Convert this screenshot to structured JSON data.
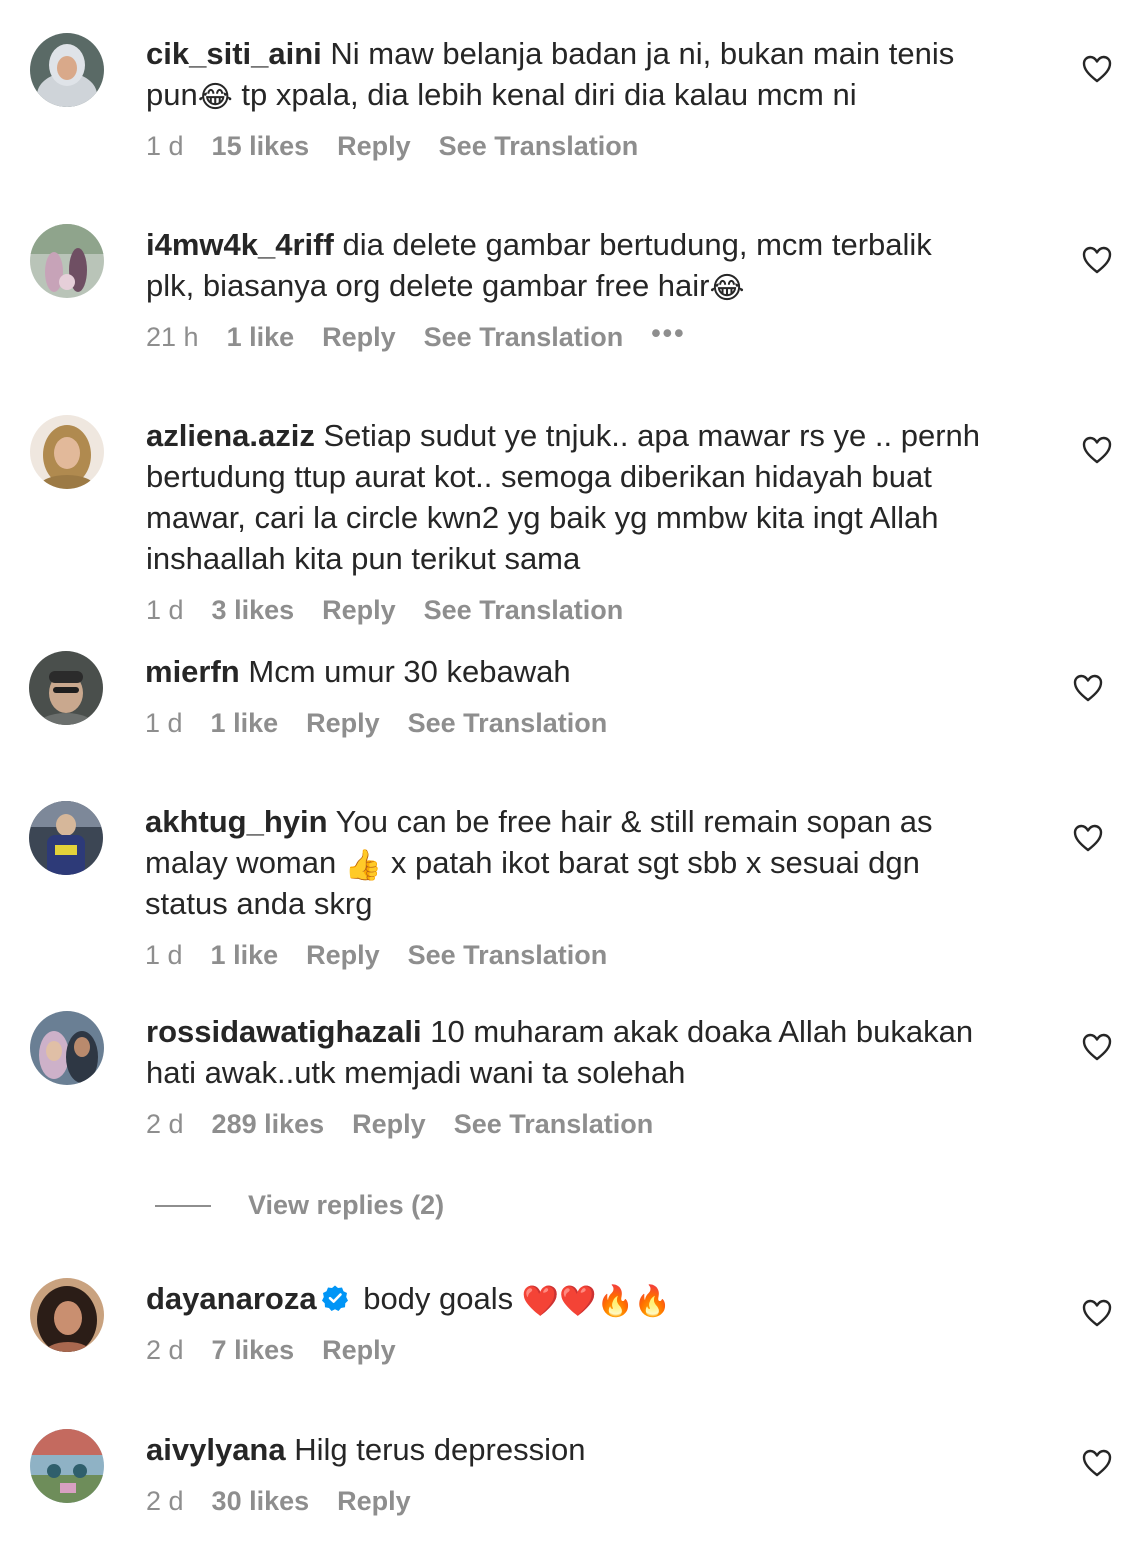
{
  "comments": [
    {
      "username": "cik_siti_aini",
      "text_lines": [
        "Ni maw belanja badan ja ni, bukan main tenis",
        "pun",
        "tp xpala, dia lebih kenal diri dia kalau mcm ni"
      ],
      "emoji": "😂",
      "time": "1 d",
      "likes": "15 likes",
      "reply": "Reply",
      "translation": "See Translation"
    },
    {
      "username": "i4mw4k_4riff",
      "text_lines": [
        "dia delete gambar bertudung, mcm terbalik",
        "plk, biasanya org delete gambar free hair"
      ],
      "emoji": "😂",
      "time": "21 h",
      "likes": "1 like",
      "reply": "Reply",
      "translation": "See Translation",
      "more": "•••"
    },
    {
      "username": "azliena.aziz",
      "text_lines": [
        "Setiap sudut ye tnjuk.. apa mawar rs ye .. pernh",
        "bertudung ttup aurat kot.. semoga diberikan hidayah buat",
        "mawar, cari la circle kwn2 yg baik yg mmbw kita ingt Allah",
        "inshaallah kita pun terikut sama"
      ],
      "time": "1 d",
      "likes": "3 likes",
      "reply": "Reply",
      "translation": "See Translation"
    },
    {
      "username": "mierfn",
      "text_lines": [
        "Mcm umur 30 kebawah"
      ],
      "time": "1 d",
      "likes": "1 like",
      "reply": "Reply",
      "translation": "See Translation"
    },
    {
      "username": "akhtug_hyin",
      "text_lines": [
        "You can be free hair & still remain sopan as",
        "malay woman",
        "x patah ikot barat sgt sbb x sesuai dgn",
        "status anda skrg"
      ],
      "emoji": "👍",
      "time": "1 d",
      "likes": "1 like",
      "reply": "Reply",
      "translation": "See Translation"
    },
    {
      "username": "rossidawatighazali",
      "text_lines": [
        "10 muharam akak doaka Allah bukakan",
        "hati awak..utk memjadi wani ta solehah"
      ],
      "time": "2 d",
      "likes": "289 likes",
      "reply": "Reply",
      "translation": "See Translation"
    },
    {
      "username": "dayanaroza",
      "text_lines": [
        "body goals"
      ],
      "emoji": "❤️❤️🔥🔥",
      "time": "2 d",
      "likes": "7 likes",
      "reply": "Reply"
    },
    {
      "username": "aivylyana",
      "text_lines": [
        "Hilg terus depression"
      ],
      "time": "2 d",
      "likes": "30 likes",
      "reply": "Reply"
    }
  ],
  "view_replies": "View replies (2)",
  "icons": {
    "like": "heart-outline-icon",
    "verified": "verified-badge-icon"
  },
  "colors": {
    "text": "#262626",
    "secondary": "#8e8e8e",
    "verified": "#0095f6"
  }
}
